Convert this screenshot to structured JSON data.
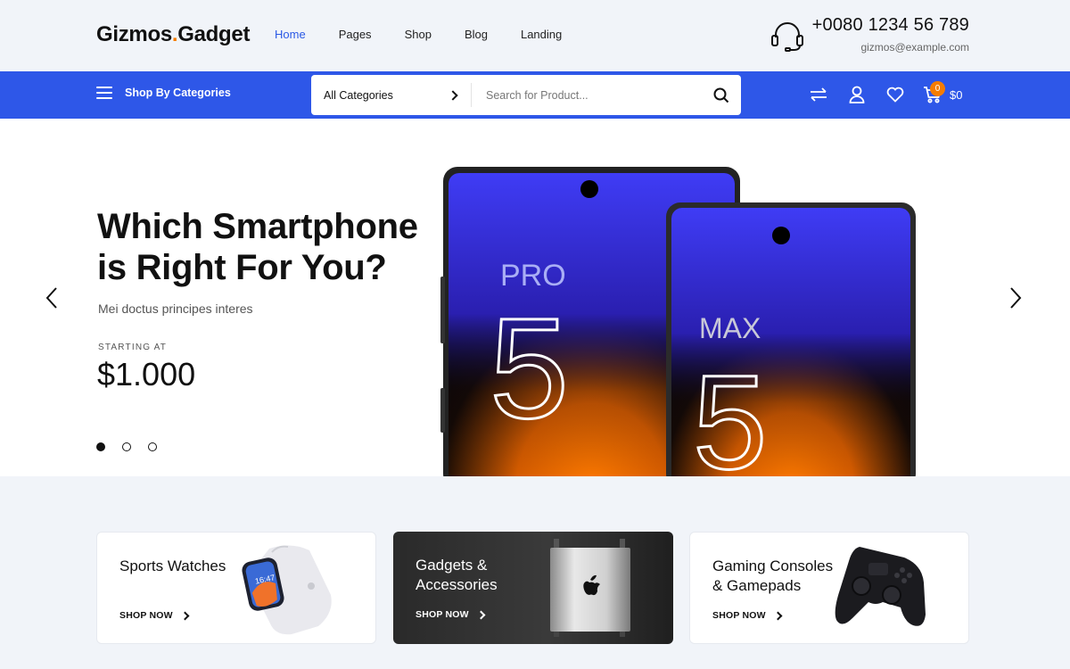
{
  "header": {
    "logo_main": "Gizmos",
    "logo_dot": ".",
    "logo_rest": "Gadget",
    "nav": [
      "Home",
      "Pages",
      "Shop",
      "Blog",
      "Landing"
    ],
    "phone": "+0080 1234 56 789",
    "email": "gizmos@example.com"
  },
  "toolbar": {
    "categories_label": "Shop By Categories",
    "select_value": "All Categories",
    "search_placeholder": "Search for Product...",
    "cart_count": "0",
    "cart_total": "$0"
  },
  "hero": {
    "title": "Which Smartphone is Right For You?",
    "subtitle": "Mei doctus principes interes",
    "starting_label": "STARTING AT",
    "price": "$1.000",
    "slides": 3,
    "active_slide": 1,
    "phone1_model": "PRO",
    "phone1_number": "5",
    "phone2_model": "MAX",
    "phone2_number": "5"
  },
  "cards": [
    {
      "title": "Sports Watches",
      "cta": "SHOP NOW",
      "watch_time": "16:47"
    },
    {
      "title": "Gadgets & Accessories",
      "cta": "SHOP NOW"
    },
    {
      "title": "Gaming Consoles & Gamepads",
      "cta": "SHOP NOW"
    }
  ],
  "colors": {
    "accent": "#2e57e8",
    "orange": "#f57c00",
    "active_nav": "#2b59e5"
  }
}
